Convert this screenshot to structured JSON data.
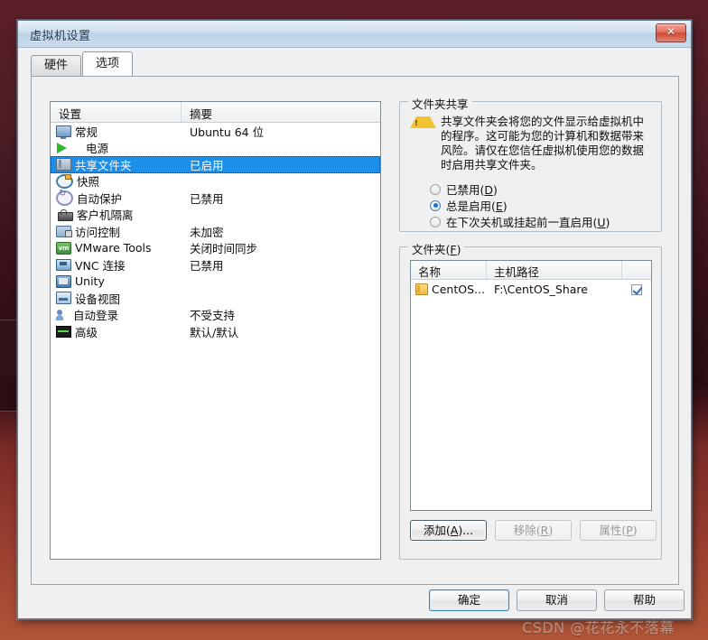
{
  "window": {
    "title": "虚拟机设置",
    "close_label": "✕"
  },
  "tabs": [
    {
      "label": "硬件",
      "active": false
    },
    {
      "label": "选项",
      "active": true
    }
  ],
  "settings_list": {
    "headers": {
      "name": "设置",
      "summary": "摘要"
    },
    "rows": [
      {
        "icon": "monitor-icon",
        "name": "常规",
        "summary": "Ubuntu 64 位",
        "selected": false
      },
      {
        "icon": "power-icon",
        "name": "电源",
        "summary": "",
        "selected": false
      },
      {
        "icon": "folder-icon",
        "name": "共享文件夹",
        "summary": "已启用",
        "selected": true
      },
      {
        "icon": "snapshot-icon",
        "name": "快照",
        "summary": "",
        "selected": false
      },
      {
        "icon": "autoprotect-icon",
        "name": "自动保护",
        "summary": "已禁用",
        "selected": false
      },
      {
        "icon": "lock-icon",
        "name": "客户机隔离",
        "summary": "",
        "selected": false
      },
      {
        "icon": "access-icon",
        "name": "访问控制",
        "summary": "未加密",
        "selected": false
      },
      {
        "icon": "vmware-tools-icon",
        "name": "VMware Tools",
        "summary": "关闭时间同步",
        "selected": false
      },
      {
        "icon": "vnc-icon",
        "name": "VNC 连接",
        "summary": "已禁用",
        "selected": false
      },
      {
        "icon": "unity-icon",
        "name": "Unity",
        "summary": "",
        "selected": false
      },
      {
        "icon": "device-view-icon",
        "name": "设备视图",
        "summary": "",
        "selected": false
      },
      {
        "icon": "autologin-icon",
        "name": "自动登录",
        "summary": "不受支持",
        "selected": false
      },
      {
        "icon": "advanced-icon",
        "name": "高级",
        "summary": "默认/默认",
        "selected": false
      }
    ]
  },
  "folder_sharing": {
    "legend": "文件夹共享",
    "warning_icon": "warning-icon",
    "warning_text": "共享文件夹会将您的文件显示给虚拟机中的程序。这可能为您的计算机和数据带来风险。请仅在您信任虚拟机使用您的数据时启用共享文件夹。",
    "options": [
      {
        "label": "已禁用(D)",
        "text": "已禁用(",
        "accel": "D",
        "tail": ")",
        "selected": false
      },
      {
        "label": "总是启用(E)",
        "text": "总是启用(",
        "accel": "E",
        "tail": ")",
        "selected": true
      },
      {
        "label": "在下次关机或挂起前一直启用(U)",
        "text": "在下次关机或挂起前一直启用(",
        "accel": "U",
        "tail": ")",
        "selected": false
      }
    ]
  },
  "folders": {
    "legend_text": "文件夹(",
    "legend_accel": "F",
    "legend_tail": ")",
    "headers": {
      "name": "名称",
      "host_path": "主机路径",
      "enabled": ""
    },
    "rows": [
      {
        "icon": "folder-yellow-icon",
        "name": "CentOS...",
        "host_path": "F:\\CentOS_Share",
        "enabled": true
      }
    ],
    "buttons": [
      {
        "text": "添加(",
        "accel": "A",
        "tail": ")...",
        "state": "focus"
      },
      {
        "text": "移除(",
        "accel": "R",
        "tail": ")",
        "state": "disabled"
      },
      {
        "text": "属性(",
        "accel": "P",
        "tail": ")",
        "state": "disabled"
      }
    ]
  },
  "footer": {
    "ok": "确定",
    "cancel": "取消",
    "help": "帮助"
  },
  "watermark": "CSDN @花花永不落幕"
}
